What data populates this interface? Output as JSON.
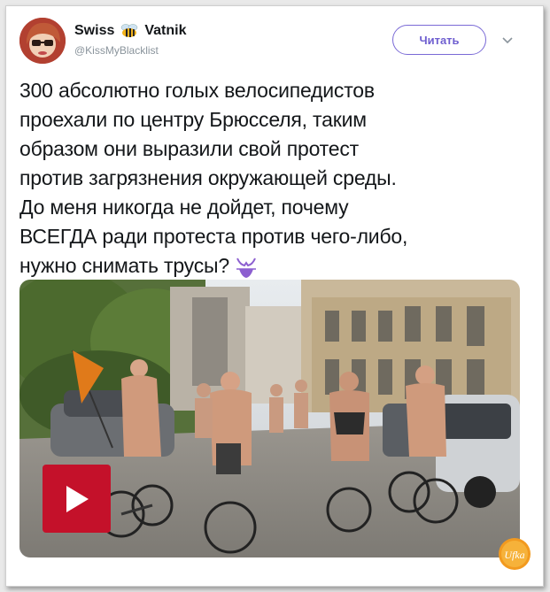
{
  "tweet": {
    "author_name_left": "Swiss",
    "author_name_right": "Vatnik",
    "handle": "@KissMyBlacklist",
    "follow_label": "Читать",
    "lines": [
      "300 абсолютно голых велосипедистов",
      "проехали по центру Брюсселя, таким",
      "образом они выразили свой протест",
      "против  загрязнения окружающей среды.",
      "До меня никогда не дойдет, почему",
      "ВСЕГДА ради протеста против чего-либо,",
      "нужно снимать трусы?"
    ]
  },
  "media": {
    "kind": "video thumbnail"
  },
  "watermark": {
    "text": "Ufka"
  },
  "icons": {
    "bee": "bee-icon",
    "bikini": "bikini-icon",
    "play": "play-icon",
    "chevron": "chevron-down-icon"
  },
  "colors": {
    "accent": "#6f5fd0",
    "play_red": "#c4112a",
    "bikini_purple": "#8c5fd0"
  }
}
